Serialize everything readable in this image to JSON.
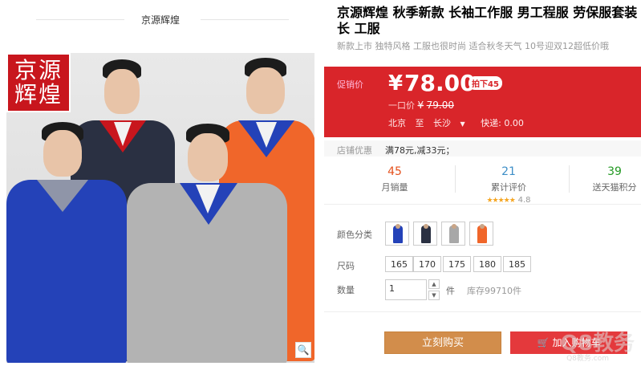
{
  "store": {
    "name": "京源辉煌"
  },
  "logo": {
    "text": "京源\n辉煌"
  },
  "product": {
    "title": "京源辉煌 秋季新款 长袖工作服 男工程服 劳保服套装长 工服",
    "subtitle": "新款上市 独特风格 工服也很时尚 适合秋冬天气 10号迎双12超低价哦"
  },
  "price": {
    "label": "促销价",
    "currency": "¥",
    "value": "78.00",
    "tag": "拍下45",
    "original_label": "一口价",
    "original_currency": "¥",
    "original_value": "79.00"
  },
  "shipping": {
    "from": "北京",
    "to_label": "至",
    "to": "长沙",
    "express": "快递: 0.00"
  },
  "store_promo": {
    "label": "店铺优惠",
    "value": "满78元,减33元；"
  },
  "stats": [
    {
      "num": "45",
      "label": "月销量",
      "color": "#e5511d"
    },
    {
      "num": "21",
      "label": "累计评价",
      "color": "#3d8ec7",
      "stars": "★★★★★",
      "rating": "4.8"
    },
    {
      "num": "39",
      "label": "送天猫积分",
      "color": "#229922"
    }
  ],
  "colors": {
    "label": "颜色分类",
    "items": [
      {
        "name": "blue",
        "color": "#2442b8"
      },
      {
        "name": "navy",
        "color": "#2a3042"
      },
      {
        "name": "gray",
        "color": "#a8a8a8"
      },
      {
        "name": "orange",
        "color": "#f0662a"
      }
    ]
  },
  "sizes": {
    "label": "尺码",
    "items": [
      "165",
      "170",
      "175",
      "180",
      "185"
    ]
  },
  "quantity": {
    "label": "数量",
    "value": "1",
    "unit": "件",
    "stock": "库存99710件"
  },
  "actions": {
    "buy_now": "立刻购买",
    "add_cart": "加入购物车"
  },
  "watermark": {
    "text": "Q8教务",
    "sub": "Q8教务.com"
  },
  "theme": {
    "accent": "#d9252a",
    "buy": "#d28d4b"
  }
}
